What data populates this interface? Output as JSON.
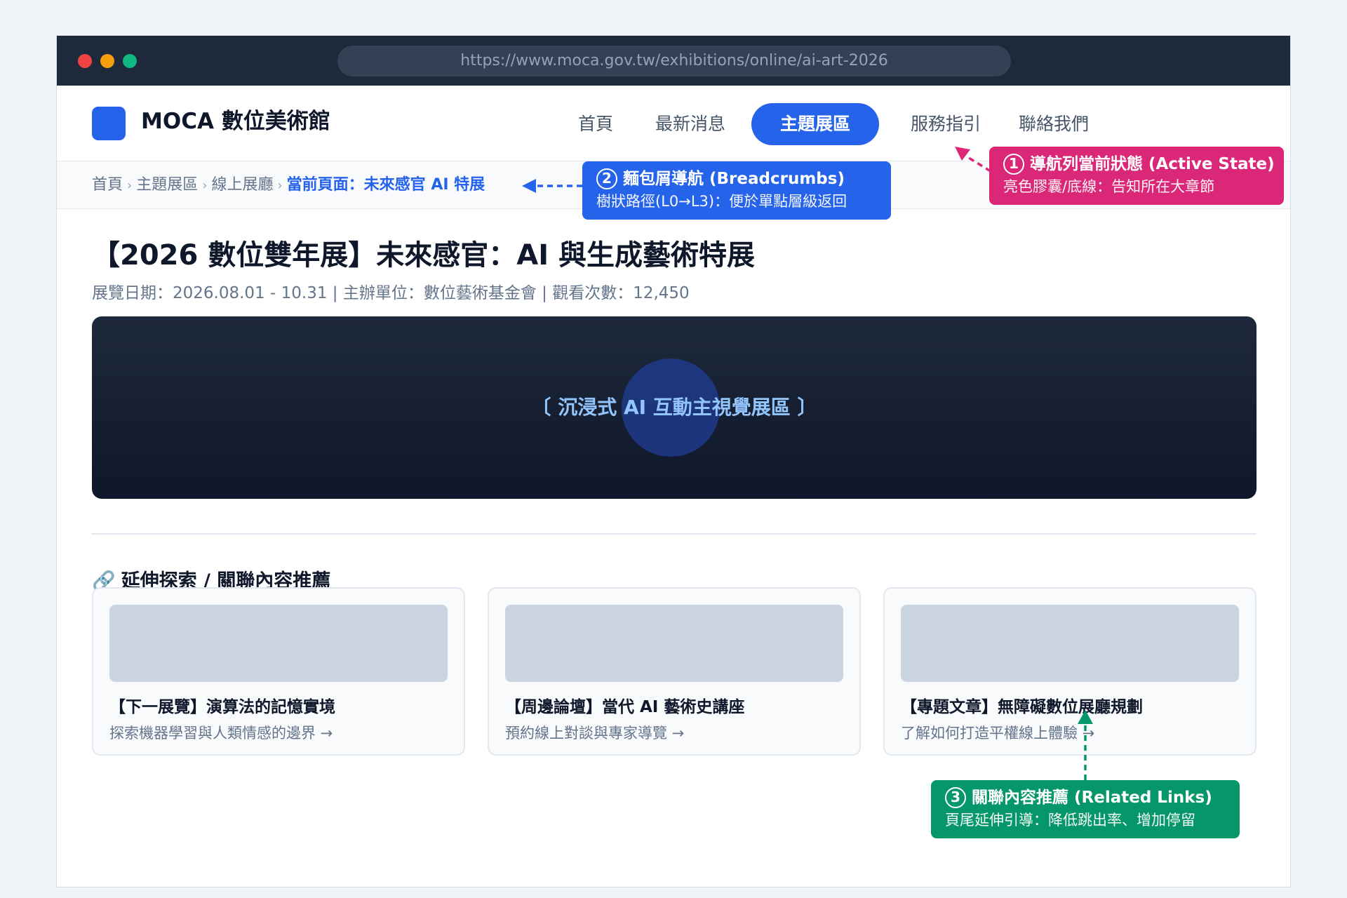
{
  "browser": {
    "url": "https://www.moca.gov.tw/exhibitions/online/ai-art-2026"
  },
  "site": {
    "logo_text": "MOCA 數位美術館"
  },
  "nav": {
    "items": [
      {
        "label": "首頁"
      },
      {
        "label": "最新消息"
      },
      {
        "label": "主題展區"
      },
      {
        "label": "服務指引"
      },
      {
        "label": "聯絡我們"
      }
    ],
    "active_index": 2
  },
  "breadcrumb": {
    "items": [
      "首頁",
      "主題展區",
      "線上展廳"
    ],
    "current": "當前頁面：未來感官 AI 特展",
    "separator": "›"
  },
  "page": {
    "title": "【2026 數位雙年展】未來感官：AI 與生成藝術特展",
    "meta": "展覽日期：2026.08.01 - 10.31 | 主辦單位：數位藝術基金會 | 觀看次數：12,450"
  },
  "hero": {
    "label": "〔 沉浸式 AI 互動主視覺展區 〕"
  },
  "related": {
    "section_icon": "link-icon",
    "section_title": "延伸探索 / 關聯內容推薦",
    "cards": [
      {
        "title": "【下一展覽】演算法的記憶實境",
        "desc": "探索機器學習與人類情感的邊界 →"
      },
      {
        "title": "【周邊論壇】當代 AI 藝術史講座",
        "desc": "預約線上對談與專家導覽 →"
      },
      {
        "title": "【專題文章】無障礙數位展廳規劃",
        "desc": "了解如何打造平權線上體驗 →"
      }
    ]
  },
  "annotations": [
    {
      "num": "1",
      "title": "導航列當前狀態 (Active State)",
      "desc": "亮色膠囊/底線：告知所在大章節",
      "color": "#db2777"
    },
    {
      "num": "2",
      "title": "麵包屑導航 (Breadcrumbs)",
      "desc": "樹狀路徑(L0→L3)：便於單點層級返回",
      "color": "#2563eb"
    },
    {
      "num": "3",
      "title": "關聯內容推薦 (Related Links)",
      "desc": "頁尾延伸引導：降低跳出率、增加停留",
      "color": "#059669"
    }
  ],
  "colors": {
    "accent": "#2563eb",
    "titlebar": "#1e293b",
    "hero_bg": "#0f172a",
    "annotation_pink": "#db2777",
    "annotation_green": "#059669"
  }
}
